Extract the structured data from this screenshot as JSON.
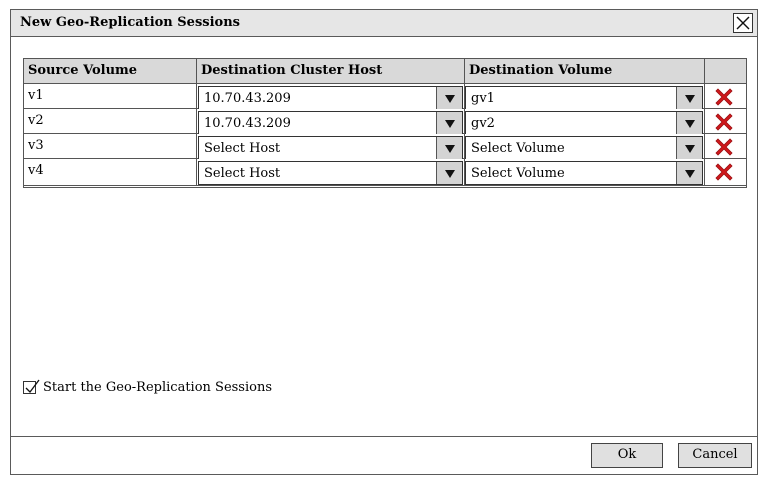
{
  "dialog": {
    "title": "New Geo-Replication Sessions",
    "close_icon": "close-icon"
  },
  "table": {
    "columns": [
      "Source Volume",
      "Destination Cluster Host",
      "Destination Volume",
      ""
    ],
    "rows": [
      {
        "source": "v1",
        "host": "10.70.43.209",
        "volume": "gv1"
      },
      {
        "source": "v2",
        "host": "10.70.43.209",
        "volume": "gv2"
      },
      {
        "source": "v3",
        "host": "Select Host",
        "volume": "Select Volume"
      },
      {
        "source": "v4",
        "host": "Select Host",
        "volume": "Select Volume"
      }
    ],
    "delete_icon": "delete-x-icon",
    "dropdown_icon": "dropdown-arrow-icon"
  },
  "options": {
    "start_sessions_label": "Start the Geo-Replication Sessions",
    "start_sessions_checked": true
  },
  "footer": {
    "ok_label": "Ok",
    "cancel_label": "Cancel"
  },
  "colors": {
    "header_bg": "#d9d9d9",
    "titlebar_bg": "#e6e6e6",
    "delete_red": "#d0191c"
  }
}
